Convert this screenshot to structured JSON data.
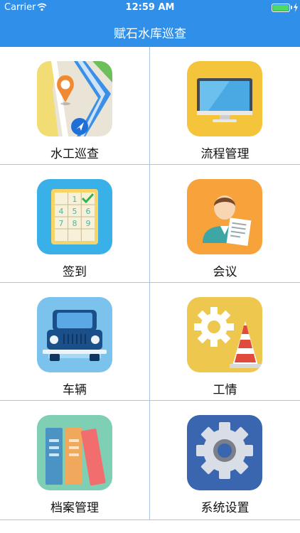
{
  "status_bar": {
    "carrier": "Carrier",
    "time": "12:59 AM"
  },
  "nav": {
    "title": "赋石水库巡查"
  },
  "colors": {
    "header": "#2f8fe9",
    "grid_line": "#a8c4e0"
  },
  "menu": [
    {
      "label": "水工巡查",
      "icon": "map-pin-icon"
    },
    {
      "label": "流程管理",
      "icon": "monitor-icon"
    },
    {
      "label": "签到",
      "icon": "checkin-grid-icon"
    },
    {
      "label": "会议",
      "icon": "person-document-icon"
    },
    {
      "label": "车辆",
      "icon": "car-icon"
    },
    {
      "label": "工情",
      "icon": "gear-cone-icon"
    },
    {
      "label": "档案管理",
      "icon": "binders-icon"
    },
    {
      "label": "系统设置",
      "icon": "settings-gear-icon"
    }
  ]
}
